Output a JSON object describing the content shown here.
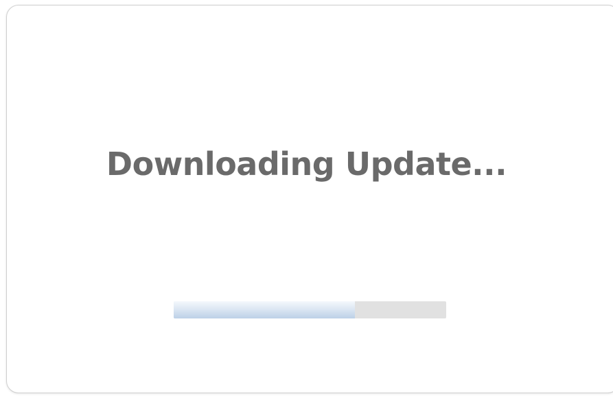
{
  "dialog": {
    "title": "Downloading Update...",
    "progress": {
      "fraction": 0.665,
      "fill_color": "#c7d8eb",
      "track_color": "#e1e1e1"
    }
  },
  "colors": {
    "title_text": "#6a6a6a",
    "border": "#cfcfcf",
    "background": "#ffffff"
  }
}
